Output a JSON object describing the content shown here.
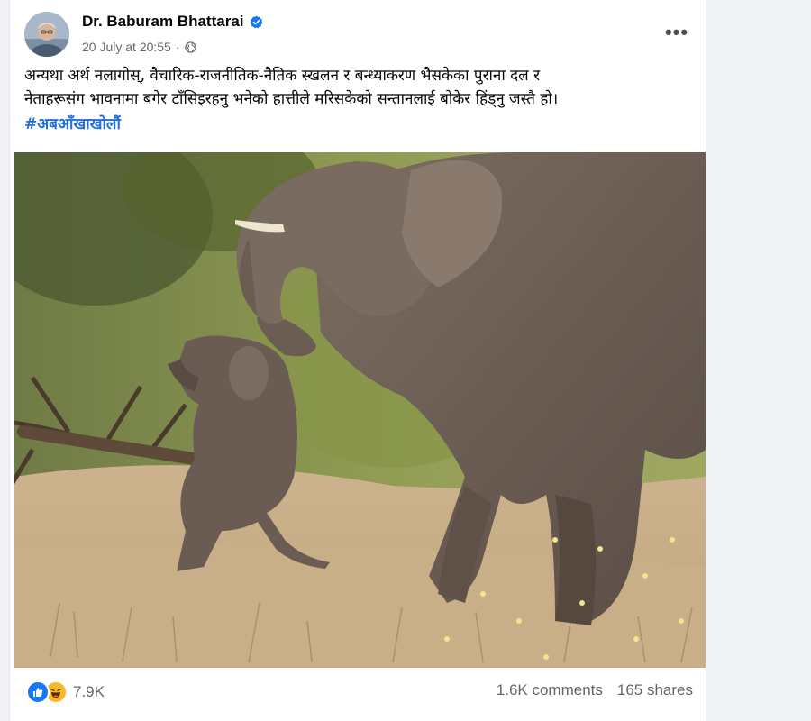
{
  "post": {
    "author_name": "Dr. Baburam Bhattarai",
    "timestamp": "20 July at 20:55",
    "visibility_icon": "globe-icon",
    "verified_icon": "verified-badge-icon",
    "more_label": "•••",
    "text_line1": "अन्यथा अर्थ नलागोस्, वैचारिक-राजनीतिक-नैतिक स्खलन र बन्ध्याकरण भैसकेका पुराना दल र",
    "text_line2": "नेताहरूसंग भावनामा बगेर टाँसिइरहनु भनेको हात्तीले मरिसकेको सन्तानलाई बोकेर हिंड्नु जस्तै हो।",
    "hashtag": "#अबआँखाखोलौं",
    "image_subject": "elephant-carrying-calf-photo"
  },
  "engagement": {
    "reaction_icons": [
      "like-icon",
      "haha-icon"
    ],
    "reaction_count": "7.9K",
    "comments": "1.6K comments",
    "shares": "165 shares"
  },
  "colors": {
    "link_blue": "#216fdb",
    "like_blue": "#1877f2",
    "haha_yellow": "#f7b928",
    "meta_gray": "#65676b"
  }
}
